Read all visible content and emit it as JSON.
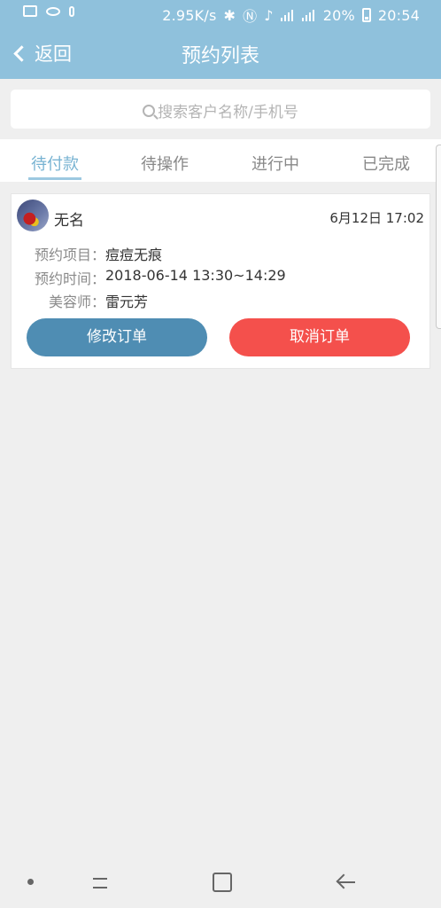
{
  "status_bar": {
    "speed": "2.95K/s",
    "battery": "20%",
    "time": "20:54",
    "icons": [
      "image-icon",
      "eye-icon",
      "mic-icon",
      "bluetooth-icon",
      "nfc-icon",
      "mute-icon",
      "signal-4g-icon",
      "signal-icon",
      "battery-icon"
    ]
  },
  "header": {
    "back_label": "返回",
    "title": "预约列表",
    "bg_color": "#8fc1dc"
  },
  "search": {
    "placeholder": "搜索客户名称/手机号"
  },
  "tabs": [
    {
      "label": "待付款",
      "active": true
    },
    {
      "label": "待操作",
      "active": false
    },
    {
      "label": "进行中",
      "active": false
    },
    {
      "label": "已完成",
      "active": false
    }
  ],
  "orders": [
    {
      "customer": "无名",
      "created_at": "6月12日 17:02",
      "fields": [
        {
          "label": "预约项目：",
          "value": "痘痘无痕"
        },
        {
          "label": "预约时间：",
          "value": "2018-06-14 13:30~14:29"
        },
        {
          "label": "美容师：",
          "value": "雷元芳"
        }
      ],
      "edit_label": "修改订单",
      "cancel_label": "取消订单"
    }
  ],
  "colors": {
    "accent": "#78b3d2",
    "edit_button": "#4f8db3",
    "cancel_button": "#f4504c"
  },
  "nav_bar": {
    "buttons": [
      "dot-icon",
      "recents-icon",
      "home-icon",
      "back-arrow-icon"
    ]
  }
}
